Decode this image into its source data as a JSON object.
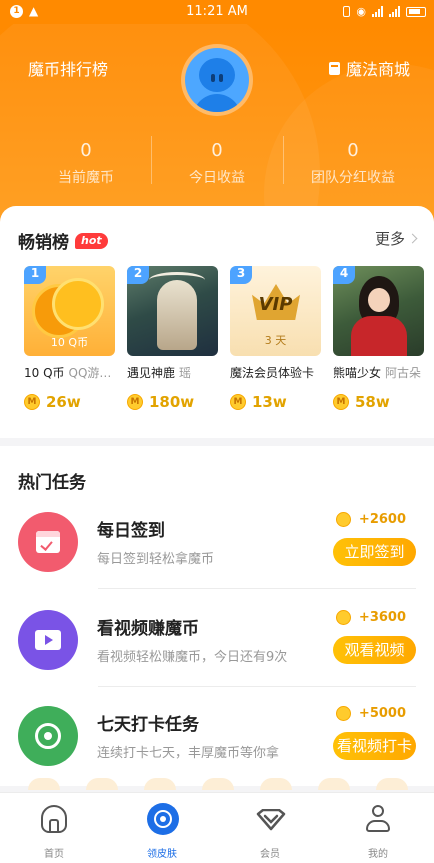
{
  "status_bar": {
    "time": "11:21 AM",
    "left_badge": "1"
  },
  "header": {
    "rank_link": "魔币排行榜",
    "shop_link": "魔法商城",
    "stats": [
      {
        "value": "0",
        "label": "当前魔币"
      },
      {
        "value": "0",
        "label": "今日收益"
      },
      {
        "value": "0",
        "label": "团队分红收益"
      }
    ]
  },
  "bestseller": {
    "title": "畅销榜",
    "badge": "hot",
    "more": "更多",
    "items": [
      {
        "rank": "1",
        "image_caption": "10 Q币",
        "name": "10 Q币",
        "sub": "QQ游…",
        "price": "26w"
      },
      {
        "rank": "2",
        "image_caption": "",
        "name": "遇见神鹿",
        "sub": "瑶",
        "price": "180w"
      },
      {
        "rank": "3",
        "image_caption": "3 天",
        "image_title": "VIP",
        "name": "魔法会员体验卡",
        "sub": "",
        "price": "13w"
      },
      {
        "rank": "4",
        "image_caption": "",
        "name": "熊喵少女",
        "sub": "阿古朵",
        "price": "58w"
      }
    ],
    "coin_glyph": "M"
  },
  "tasks": {
    "title": "热门任务",
    "items": [
      {
        "name": "每日签到",
        "desc": "每日签到轻松拿魔币",
        "reward": "+2600",
        "button": "立即签到",
        "icon": "calendar-check-icon",
        "color": "#f25b6e"
      },
      {
        "name": "看视频赚魔币",
        "desc": "看视频轻松赚魔币，今日还有9次",
        "reward": "+3600",
        "button": "观看视频",
        "icon": "video-play-icon",
        "color": "#7a53e6"
      },
      {
        "name": "七天打卡任务",
        "desc": "连续打卡七天，丰厚魔币等你拿",
        "reward": "+5000",
        "button": "看视频打卡",
        "icon": "location-pin-icon",
        "color": "#3fae5a"
      }
    ]
  },
  "tabbar": {
    "tabs": [
      {
        "label": "首页",
        "active": false
      },
      {
        "label": "领皮肤",
        "active": true
      },
      {
        "label": "会员",
        "active": false
      },
      {
        "label": "我的",
        "active": false
      }
    ],
    "active_color": "#1d6ee6"
  },
  "colors": {
    "brand": "#ff8a00",
    "accent_yellow": "#ffb300"
  }
}
